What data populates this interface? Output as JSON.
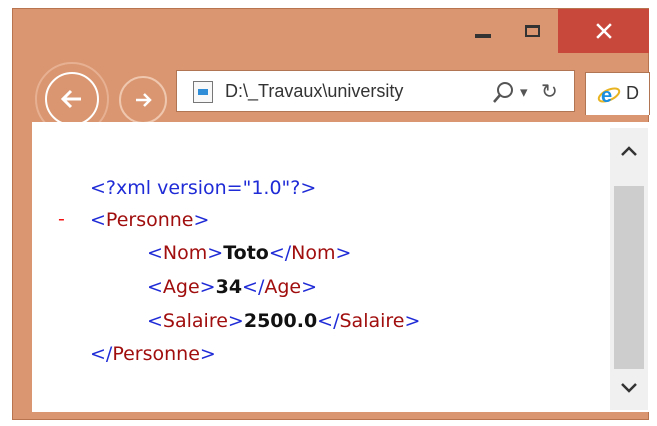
{
  "window": {
    "minimize_icon": "minimize-icon",
    "maximize_icon": "maximize-icon",
    "close_glyph": "✕",
    "close_color": "#c9483c",
    "frame_color": "#d99670"
  },
  "navigation": {
    "back_icon": "back-arrow-icon",
    "forward_icon": "forward-arrow-icon"
  },
  "address_bar": {
    "url": "D:\\_Travaux\\university",
    "search_icon": "search-icon",
    "dropdown_glyph": "▾",
    "refresh_glyph": "↻"
  },
  "tab": {
    "label": "D",
    "icon": "internet-explorer-icon"
  },
  "xml_view": {
    "collapse_marker": "-",
    "colors": {
      "tag": "#1f2bd6",
      "element_name": "#a10e0e",
      "value": "#111111",
      "collapse": "#f41111"
    },
    "lines": [
      {
        "text": "<?xml version=\"1.0\"?>"
      },
      {
        "open": "<",
        "name": "Personne",
        "close": ">"
      },
      {
        "open": "<",
        "name": "Nom",
        "close": ">",
        "value": "Toto",
        "end_open": "</",
        "end_name": "Nom",
        "end_close": ">"
      },
      {
        "open": "<",
        "name": "Age",
        "close": ">",
        "value": "34",
        "end_open": "</",
        "end_name": "Age",
        "end_close": ">"
      },
      {
        "open": "<",
        "name": "Salaire",
        "close": ">",
        "value": "2500.0",
        "end_open": "</",
        "end_name": "Salaire",
        "end_close": ">"
      },
      {
        "open": "</",
        "name": "Personne",
        "close": ">"
      }
    ]
  },
  "scrollbar": {
    "up_icon": "scroll-up-icon",
    "down_icon": "scroll-down-icon"
  }
}
